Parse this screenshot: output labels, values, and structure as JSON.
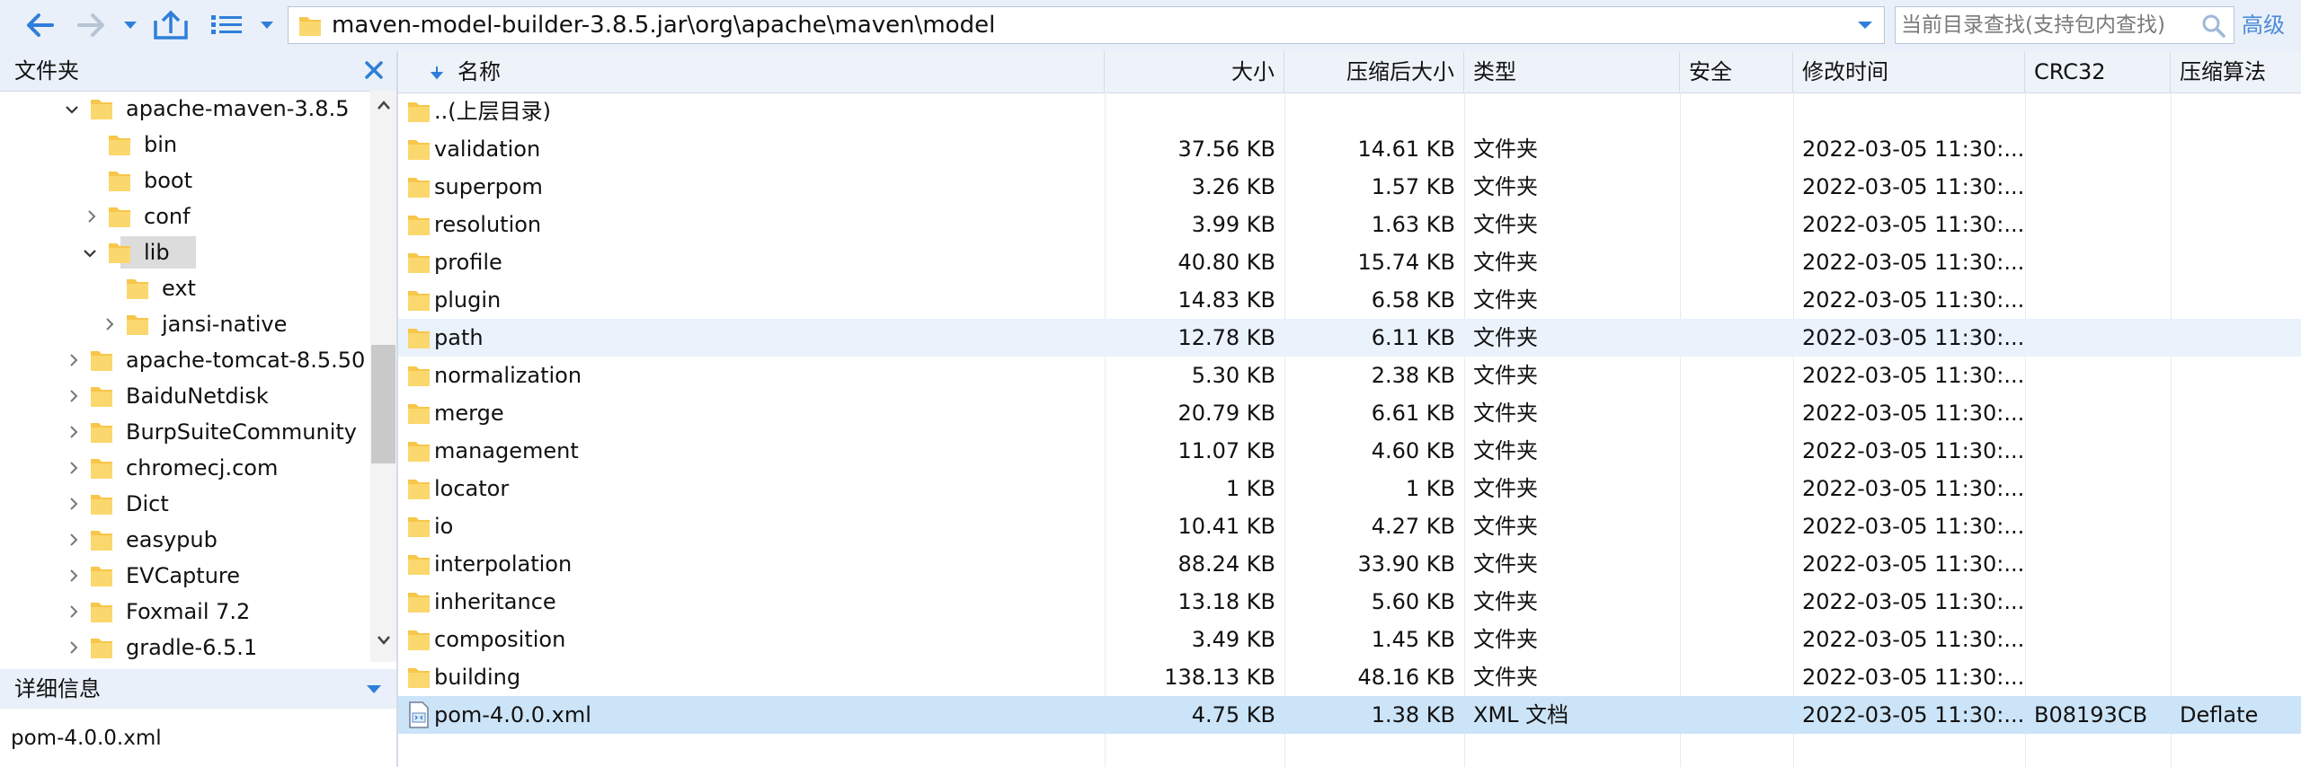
{
  "toolbar": {
    "path": "maven-model-builder-3.8.5.jar\\org\\apache\\maven\\model",
    "search_placeholder": "当前目录查找(支持包内查找)",
    "advanced": "高级"
  },
  "left": {
    "title": "文件夹",
    "tree": [
      {
        "label": "apache-maven-3.8.5",
        "expanded": true
      },
      {
        "label": "bin"
      },
      {
        "label": "boot"
      },
      {
        "label": "conf"
      },
      {
        "label": "lib",
        "selected": true,
        "expanded": true
      },
      {
        "label": "ext"
      },
      {
        "label": "jansi-native"
      },
      {
        "label": "apache-tomcat-8.5.50"
      },
      {
        "label": "BaiduNetdisk"
      },
      {
        "label": "BurpSuiteCommunity"
      },
      {
        "label": "chromecj.com"
      },
      {
        "label": "Dict"
      },
      {
        "label": "easypub"
      },
      {
        "label": "EVCapture"
      },
      {
        "label": "Foxmail 7.2"
      },
      {
        "label": "gradle-6.5.1"
      }
    ],
    "detail_title": "详细信息",
    "detail_file": "pom-4.0.0.xml"
  },
  "columns": [
    "名称",
    "大小",
    "压缩后大小",
    "类型",
    "安全",
    "修改时间",
    "CRC32",
    "压缩算法"
  ],
  "files": [
    {
      "name": "..(上层目录)",
      "size": "",
      "packed": "",
      "type": "",
      "modified": "",
      "crc": "",
      "method": ""
    },
    {
      "name": "validation",
      "size": "37.56 KB",
      "packed": "14.61 KB",
      "type": "文件夹",
      "modified": "2022-03-05 11:30:...",
      "crc": "",
      "method": ""
    },
    {
      "name": "superpom",
      "size": "3.26 KB",
      "packed": "1.57 KB",
      "type": "文件夹",
      "modified": "2022-03-05 11:30:...",
      "crc": "",
      "method": ""
    },
    {
      "name": "resolution",
      "size": "3.99 KB",
      "packed": "1.63 KB",
      "type": "文件夹",
      "modified": "2022-03-05 11:30:...",
      "crc": "",
      "method": ""
    },
    {
      "name": "profile",
      "size": "40.80 KB",
      "packed": "15.74 KB",
      "type": "文件夹",
      "modified": "2022-03-05 11:30:...",
      "crc": "",
      "method": ""
    },
    {
      "name": "plugin",
      "size": "14.83 KB",
      "packed": "6.58 KB",
      "type": "文件夹",
      "modified": "2022-03-05 11:30:...",
      "crc": "",
      "method": ""
    },
    {
      "name": "path",
      "size": "12.78 KB",
      "packed": "6.11 KB",
      "type": "文件夹",
      "modified": "2022-03-05 11:30:...",
      "crc": "",
      "method": ""
    },
    {
      "name": "normalization",
      "size": "5.30 KB",
      "packed": "2.38 KB",
      "type": "文件夹",
      "modified": "2022-03-05 11:30:...",
      "crc": "",
      "method": ""
    },
    {
      "name": "merge",
      "size": "20.79 KB",
      "packed": "6.61 KB",
      "type": "文件夹",
      "modified": "2022-03-05 11:30:...",
      "crc": "",
      "method": ""
    },
    {
      "name": "management",
      "size": "11.07 KB",
      "packed": "4.60 KB",
      "type": "文件夹",
      "modified": "2022-03-05 11:30:...",
      "crc": "",
      "method": ""
    },
    {
      "name": "locator",
      "size": "1 KB",
      "packed": "1 KB",
      "type": "文件夹",
      "modified": "2022-03-05 11:30:...",
      "crc": "",
      "method": ""
    },
    {
      "name": "io",
      "size": "10.41 KB",
      "packed": "4.27 KB",
      "type": "文件夹",
      "modified": "2022-03-05 11:30:...",
      "crc": "",
      "method": ""
    },
    {
      "name": "interpolation",
      "size": "88.24 KB",
      "packed": "33.90 KB",
      "type": "文件夹",
      "modified": "2022-03-05 11:30:...",
      "crc": "",
      "method": ""
    },
    {
      "name": "inheritance",
      "size": "13.18 KB",
      "packed": "5.60 KB",
      "type": "文件夹",
      "modified": "2022-03-05 11:30:...",
      "crc": "",
      "method": ""
    },
    {
      "name": "composition",
      "size": "3.49 KB",
      "packed": "1.45 KB",
      "type": "文件夹",
      "modified": "2022-03-05 11:30:...",
      "crc": "",
      "method": ""
    },
    {
      "name": "building",
      "size": "138.13 KB",
      "packed": "48.16 KB",
      "type": "文件夹",
      "modified": "2022-03-05 11:30:...",
      "crc": "",
      "method": ""
    },
    {
      "name": "pom-4.0.0.xml",
      "size": "4.75 KB",
      "packed": "1.38 KB",
      "type": "XML 文档",
      "modified": "2022-03-05 11:30:...",
      "crc": "B08193CB",
      "method": "Deflate"
    }
  ]
}
